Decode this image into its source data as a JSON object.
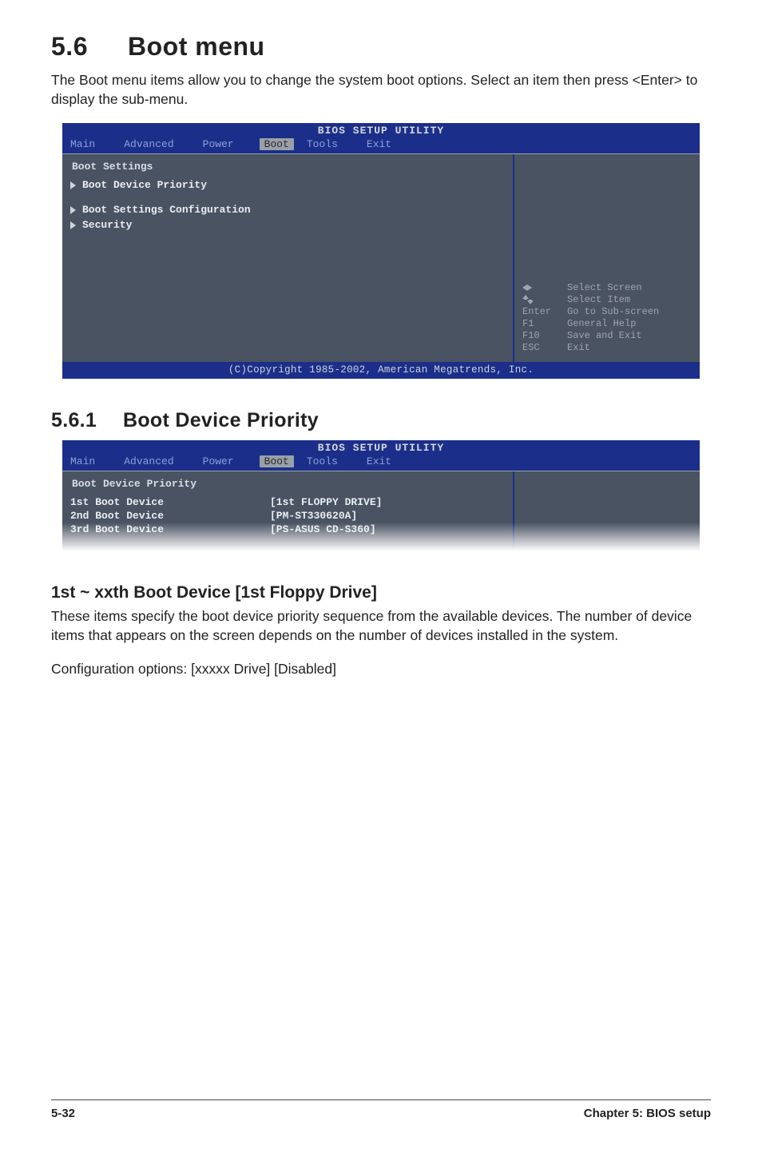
{
  "section": {
    "number": "5.6",
    "title": "Boot menu",
    "intro": "The Boot menu items allow you to change the system boot options. Select an item then press <Enter> to display the sub-menu."
  },
  "bios1": {
    "title": "BIOS SETUP UTILITY",
    "menubar": [
      "Main",
      "Advanced",
      "Power",
      "Boot",
      "Tools",
      "Exit"
    ],
    "active_tab": "Boot",
    "heading": "Boot Settings",
    "items": [
      "Boot Device Priority",
      "Boot Settings Configuration",
      "Security"
    ],
    "help": [
      {
        "key_icon": "lr",
        "label": "Select Screen"
      },
      {
        "key_icon": "ud",
        "label": "Select Item"
      },
      {
        "key": "Enter",
        "label": "Go to Sub-screen"
      },
      {
        "key": "F1",
        "label": "General Help"
      },
      {
        "key": "F10",
        "label": "Save and Exit"
      },
      {
        "key": "ESC",
        "label": "Exit"
      }
    ],
    "footer": "(C)Copyright 1985-2002, American Megatrends, Inc."
  },
  "subsection": {
    "number": "5.6.1",
    "title": "Boot Device Priority"
  },
  "bios2": {
    "title": "BIOS SETUP UTILITY",
    "menubar": [
      "Main",
      "Advanced",
      "Power",
      "Boot",
      "Tools",
      "Exit"
    ],
    "active_tab": "Boot",
    "heading": "Boot Device Priority",
    "rows": [
      {
        "k": "1st Boot Device",
        "v": "[1st FLOPPY DRIVE]"
      },
      {
        "k": "2nd Boot Device",
        "v": "[PM-ST330620A]"
      },
      {
        "k": "3rd Boot Device",
        "v": "[PS-ASUS CD-S360]"
      }
    ]
  },
  "subhead": {
    "title": "1st ~ xxth Boot Device [1st Floppy Drive]",
    "p1": "These items specify the boot device priority sequence from the available devices. The number of device items that appears on the screen depends on the number of devices installed in the system.",
    "p2": "Configuration options: [xxxxx Drive] [Disabled]"
  },
  "footer": {
    "left": "5-32",
    "right": "Chapter 5: BIOS setup"
  }
}
